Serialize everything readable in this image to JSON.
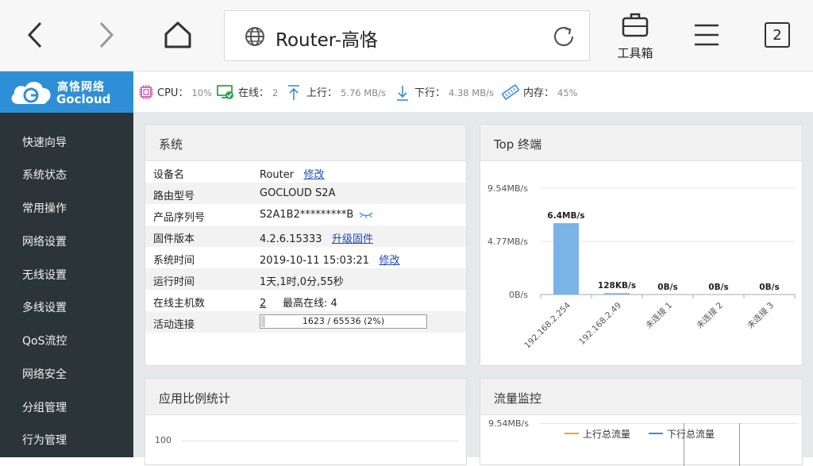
{
  "browser": {
    "url_title": "Router-高恪",
    "toolbox_label": "工具箱",
    "tab_count": "2"
  },
  "header": {
    "logo_cn": "高恪网络",
    "logo_en": "Gocloud",
    "cpu_label": "CPU：",
    "cpu_value": "10%",
    "online_label": "在线：",
    "online_value": "2",
    "up_label": "上行：",
    "up_value": "5.76 MB/s",
    "down_label": "下行：",
    "down_value": "4.38 MB/s",
    "mem_label": "内存：",
    "mem_value": "45%"
  },
  "sidebar": {
    "items": [
      {
        "label": "快速向导"
      },
      {
        "label": "系统状态"
      },
      {
        "label": "常用操作"
      },
      {
        "label": "网络设置"
      },
      {
        "label": "无线设置"
      },
      {
        "label": "多线设置"
      },
      {
        "label": "QoS流控"
      },
      {
        "label": "网络安全"
      },
      {
        "label": "分组管理"
      },
      {
        "label": "行为管理"
      }
    ]
  },
  "system": {
    "title": "系统",
    "rows": [
      {
        "key": "设备名",
        "value": "Router",
        "link": "修改"
      },
      {
        "key": "路由型号",
        "value": "GOCLOUD S2A"
      },
      {
        "key": "产品序列号",
        "value": "S2A1B2*********B"
      },
      {
        "key": "固件版本",
        "value": "4.2.6.15333",
        "link": "升级固件"
      },
      {
        "key": "系统时间",
        "value": "2019-10-11 15:03:21",
        "link": "修改"
      },
      {
        "key": "运行时间",
        "value": "1天,1时,0分,55秒"
      },
      {
        "key": "在线主机数",
        "value": "2",
        "extra_label": "最高在线:",
        "extra_value": "4"
      },
      {
        "key": "活动连接",
        "progress_text": "1623 / 65536 (2%)",
        "progress": 0.025
      }
    ]
  },
  "top_terminals": {
    "title": "Top 终端",
    "chart_data": {
      "type": "bar",
      "categories": [
        "192.168.2.254",
        "192.168.2.49",
        "未连接 1",
        "未连接 2",
        "未连接 3"
      ],
      "values": [
        6.4,
        0.125,
        0,
        0,
        0
      ],
      "value_labels": [
        "6.4MB/s",
        "128KB/s",
        "0B/s",
        "0B/s",
        "0B/s"
      ],
      "y_ticks": [
        "9.54MB/s",
        "4.77MB/s",
        "0B/s"
      ],
      "ylim": [
        0,
        9.54
      ],
      "unit": "MB/s",
      "color": "#7ab4e6"
    }
  },
  "app_ratio": {
    "title": "应用比例统计",
    "y_tick": "100"
  },
  "traffic": {
    "title": "流量监控",
    "y_tick": "9.54MB/s",
    "legend_up": "上行总流量",
    "legend_down": "下行总流量",
    "color_up": "#f0a030",
    "color_down": "#3d8bd9"
  }
}
